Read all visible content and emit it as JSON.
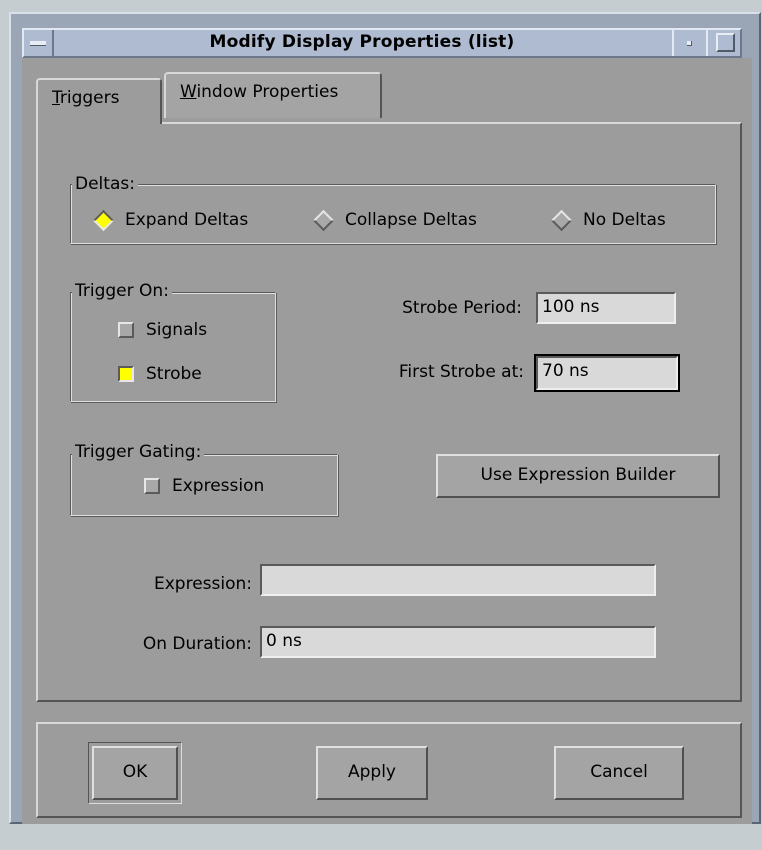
{
  "window": {
    "title": "Modify Display Properties (list)"
  },
  "tabs": [
    {
      "mnemonic": "T",
      "rest": "riggers",
      "active": true
    },
    {
      "mnemonic": "W",
      "rest": "indow Properties",
      "active": false
    }
  ],
  "deltas": {
    "title": "Deltas:",
    "options": [
      {
        "label": "Expand Deltas",
        "selected": true
      },
      {
        "label": "Collapse Deltas",
        "selected": false
      },
      {
        "label": "No Deltas",
        "selected": false
      }
    ]
  },
  "trigger_on": {
    "title": "Trigger On:",
    "options": [
      {
        "label": "Signals",
        "checked": false
      },
      {
        "label": "Strobe",
        "checked": true
      }
    ]
  },
  "strobe": {
    "period_label": "Strobe Period:",
    "period_value": "100 ns",
    "first_label": "First Strobe at:",
    "first_value": "70 ns"
  },
  "trigger_gating": {
    "title": "Trigger Gating:",
    "expression_label": "Expression",
    "expression_checked": false
  },
  "expression_builder_button": "Use Expression Builder",
  "expression": {
    "label": "Expression:",
    "value": ""
  },
  "on_duration": {
    "label": "On Duration:",
    "value": "0 ns"
  },
  "buttons": {
    "ok": "OK",
    "apply": "Apply",
    "cancel": "Cancel"
  },
  "colors": {
    "selected_indicator": "#ffff00",
    "dialog_background": "#9c9c9c",
    "titlebar": "#aebbd0"
  }
}
